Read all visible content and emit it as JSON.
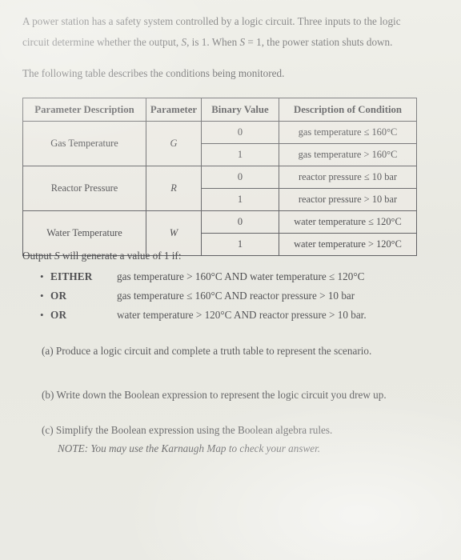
{
  "document": {
    "intro_line1": "A power station has a safety system controlled by a logic circuit. Three inputs to the logic",
    "intro_line2_a": "circuit determine whether the output, ",
    "intro_var_s1": "S",
    "intro_line2_b": ", is 1. When ",
    "intro_var_s2": "S",
    "intro_line2_c": " = 1, the power station shuts down.",
    "lead": "The following table describes the conditions being monitored."
  },
  "table": {
    "headers": [
      "Parameter Description",
      "Parameter",
      "Binary Value",
      "Description of Condition"
    ],
    "rows": [
      {
        "description": "Gas Temperature",
        "parameter": "G",
        "values": [
          {
            "binary": "0",
            "condition": "gas temperature ≤ 160°C"
          },
          {
            "binary": "1",
            "condition": "gas temperature > 160°C"
          }
        ]
      },
      {
        "description": "Reactor Pressure",
        "parameter": "R",
        "values": [
          {
            "binary": "0",
            "condition": "reactor pressure ≤ 10 bar"
          },
          {
            "binary": "1",
            "condition": "reactor pressure > 10 bar"
          }
        ]
      },
      {
        "description": "Water Temperature",
        "parameter": "W",
        "values": [
          {
            "binary": "0",
            "condition": "water temperature ≤ 120°C"
          },
          {
            "binary": "1",
            "condition": "water temperature > 120°C"
          }
        ]
      }
    ]
  },
  "output_section": {
    "intro_a": "Output ",
    "intro_var": "S",
    "intro_b": " will generate a value of 1 if:",
    "bullet_glyph": "•",
    "conditions": [
      {
        "conjunction": "EITHER",
        "text": "gas temperature > 160°C AND water temperature ≤ 120°C"
      },
      {
        "conjunction": "OR",
        "text": "gas temperature ≤ 160°C AND reactor pressure > 10 bar"
      },
      {
        "conjunction": "OR",
        "text": "water temperature > 120°C AND reactor pressure > 10 bar."
      }
    ]
  },
  "parts": {
    "a": "(a) Produce a logic circuit and complete a truth table to represent the scenario.",
    "b": "(b) Write down the Boolean expression to represent the logic circuit you drew up.",
    "c": "(c) Simplify the Boolean expression using the Boolean algebra rules.",
    "note": "NOTE: You may use the Karnaugh Map to check your answer."
  }
}
